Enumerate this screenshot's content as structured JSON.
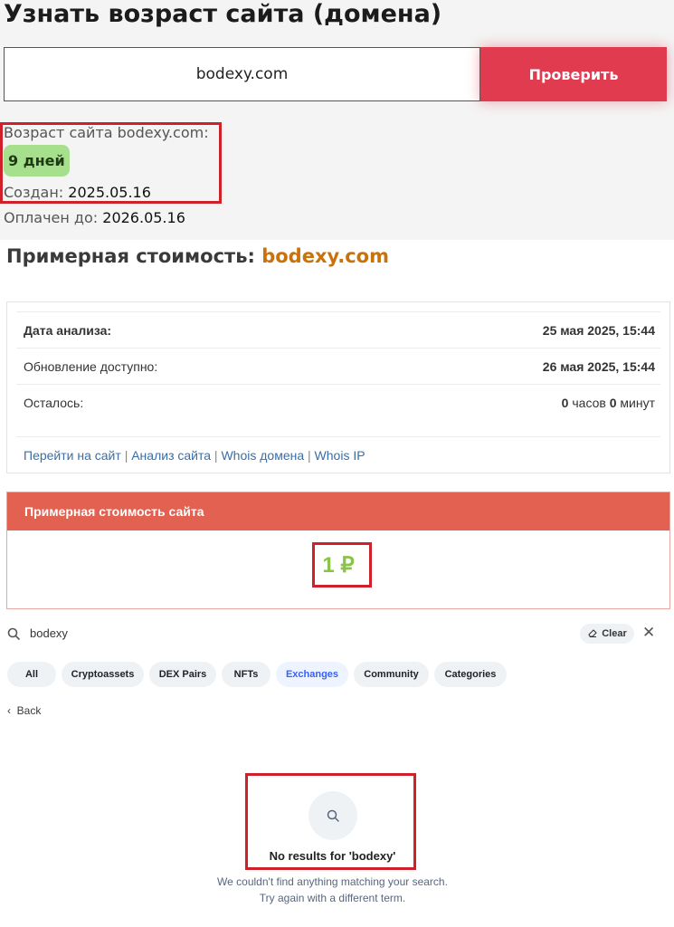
{
  "age_section": {
    "title": "Узнать возраст сайта (домена)",
    "domain_value": "bodexy.com",
    "check_button": "Проверить",
    "age_label": "Возраст сайта bodexy.com:",
    "age_badge": "9 дней",
    "created_label": "Создан:",
    "created_value": "2025.05.16",
    "paid_label": "Оплачен до:",
    "paid_value": "2026.05.16"
  },
  "cost_section": {
    "title_prefix": "Примерная стоимость:",
    "title_domain": "bodexy.com",
    "rows": [
      {
        "key": "Дата анализа:",
        "value": "25 мая 2025, 15:44"
      },
      {
        "key": "Обновление доступно:",
        "value": "26 мая 2025, 15:44"
      },
      {
        "key": "Осталось:",
        "hours_num": "0",
        "hours_unit": "часов",
        "minutes_num": "0",
        "minutes_unit": "минут"
      }
    ],
    "links": [
      "Перейти на сайт",
      "Анализ сайта",
      "Whois домена",
      "Whois IP"
    ],
    "link_separator": "|",
    "price_header": "Примерная стоимость сайта",
    "price_value": "1 ₽"
  },
  "search": {
    "query": "bodexy",
    "clear_label": "Clear",
    "close_glyph": "✕",
    "filters": [
      "All",
      "Cryptoassets",
      "DEX Pairs",
      "NFTs",
      "Exchanges",
      "Community",
      "Categories"
    ],
    "active_filter": "Exchanges",
    "back_label": "Back",
    "empty_title": "No results for 'bodexy'",
    "empty_desc_line1": "We couldn't find anything matching your search.",
    "empty_desc_line2": "Try again with a different term."
  },
  "colors": {
    "check_button": "#e03b4f",
    "age_badge": "#a6e08d",
    "domain_accent": "#c9720b",
    "price_header": "#e26151",
    "price_value": "#8bc34a",
    "link": "#3a6ea8",
    "highlight": "#d0202a",
    "active_filter": "#3861fb"
  },
  "icons": {
    "search": "search-icon",
    "clear": "eraser-icon",
    "close": "close-icon",
    "back": "chevron-left-icon",
    "empty_state": "search-icon"
  }
}
